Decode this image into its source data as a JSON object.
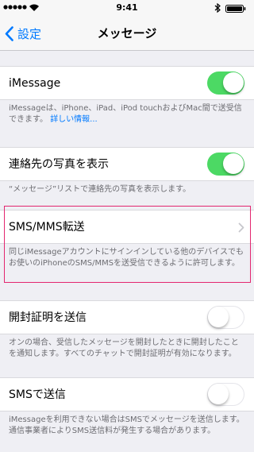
{
  "statusbar": {
    "time": "9:41"
  },
  "nav": {
    "back_label": "設定",
    "title": "メッセージ"
  },
  "cells": {
    "imessage": {
      "label": "iMessage",
      "toggle": "on"
    },
    "contact_photos": {
      "label": "連絡先の写真を表示",
      "toggle": "on"
    },
    "sms_forward": {
      "label": "SMS/MMS転送"
    },
    "read_receipts": {
      "label": "開封証明を送信",
      "toggle": "off"
    },
    "send_as_sms": {
      "label": "SMSで送信",
      "toggle": "off"
    }
  },
  "footers": {
    "imessage_text": "iMessageは、iPhone、iPad、iPod touchおよびMac間で送受信できます。",
    "imessage_link": "詳しい情報...",
    "contact_photos": "“メッセージ”リストで連絡先の写真を表示します。",
    "sms_forward": "同じiMessageアカウントにサインインしている他のデバイスでもお使いのiPhoneのSMS/MMSを送受信できるように許可します。",
    "read_receipts": "オンの場合、受信したメッセージを開封したときに開封したことを通知します。すべてのチャットで開封証明が有効になります。",
    "send_as_sms": "iMessageを利用できない場合はSMSでメッセージを送信します。通信事業者によりSMS送信料が発生する場合があります。"
  },
  "colors": {
    "accent": "#007aff",
    "toggle_on": "#4cd964",
    "highlight": "#e3266f",
    "footer_text": "#6d6d72"
  }
}
